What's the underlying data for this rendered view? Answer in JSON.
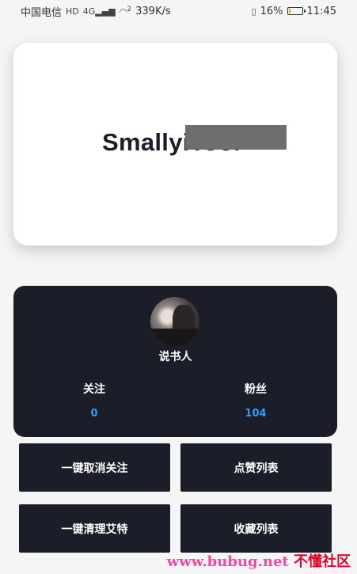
{
  "status_bar": {
    "carrier": "中国电信",
    "hd": "HD",
    "net": "4G",
    "wifi_level": "2",
    "speed": "339K/s",
    "battery_percent": "16%",
    "battery_level": 0.16,
    "time": "11:45",
    "accent_color": "#f4a400"
  },
  "hero": {
    "title": "SmallyiTool"
  },
  "profile": {
    "username": "说书人",
    "stats": [
      {
        "label": "关注",
        "value": "0"
      },
      {
        "label": "粉丝",
        "value": "104"
      }
    ],
    "value_color": "#2e9bff",
    "card_color": "#1b1d28"
  },
  "actions": [
    {
      "label": "一键取消关注"
    },
    {
      "label": "点赞列表"
    },
    {
      "label": "一键清理艾特"
    },
    {
      "label": "收藏列表"
    }
  ],
  "watermark": {
    "url": "www.bubug.net",
    "cn": "不懂社区"
  }
}
